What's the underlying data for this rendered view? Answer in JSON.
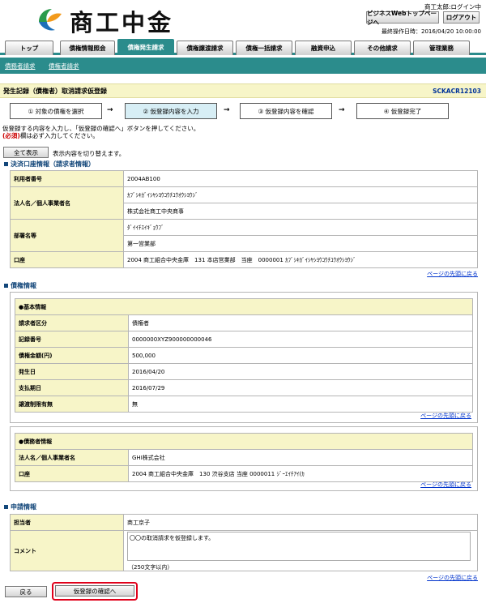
{
  "header": {
    "logo_text": "商工中金",
    "user": "商工太郎:ログイン中",
    "btn_portal": "ビジネスWebトップページへ",
    "btn_logout": "ログアウト",
    "last_operation": "最終操作日時：2016/04/20 10:00:00"
  },
  "tabs": [
    "トップ",
    "債権情報照会",
    "債権発生請求",
    "債権譲渡請求",
    "債権一括請求",
    "融資申込",
    "その他請求",
    "管理業務"
  ],
  "subnav": [
    "債務者請求",
    "債権者請求"
  ],
  "title": "発生記録（債権者）取消請求仮登録",
  "screen_code": "SCKACR12103",
  "steps": [
    "① 対象の債権を選択",
    "② 仮登録内容を入力",
    "③ 仮登録内容を確認",
    "④ 仮登録完了"
  ],
  "instruction1": "仮登録する内容を入力し、「仮登録の確認へ」ボタンを押してください。",
  "required_mark": "(必須)",
  "instruction2": "欄は必ず入力してください。",
  "toggle_button": "全て表示",
  "toggle_note": "表示内容を切り替えます。",
  "settlement": {
    "heading": "決済口座情報（請求者情報）",
    "user_no_label": "利用者番号",
    "user_no": "2004AB100",
    "name_label": "法人名／個人事業者名",
    "name_kana": "ｶﾌﾞｼｷｶﾞｲｼﾔｼﾖｳｺｳﾁﾕｳｵｳｼﾖｳｼﾞ",
    "name": "株式会社商工中央商事",
    "dept_label": "部署名等",
    "dept_kana": "ﾀﾞｲｲﾁｴｲｷﾞｮｳﾌﾞ",
    "dept": "第一営業部",
    "account_label": "口座",
    "account": "2004 商工組合中央金庫　131 本店営業部　当座　0000001 ｶﾌﾞｼｷｶﾞｲｼﾔｼﾖｳｺｳﾁﾕｳｵｳｼﾖｳｼﾞ"
  },
  "to_top": "ページの先頭に戻る",
  "claim": {
    "heading": "債権情報",
    "basic_heading": "●基本情報",
    "rows": [
      {
        "label": "請求者区分",
        "value": "債権者"
      },
      {
        "label": "記録番号",
        "value": "0000000XYZ900000000046"
      },
      {
        "label": "債権金額(円)",
        "value": "500,000"
      },
      {
        "label": "発生日",
        "value": "2016/04/20"
      },
      {
        "label": "支払期日",
        "value": "2016/07/29"
      },
      {
        "label": "譲渡制限有無",
        "value": "無"
      }
    ],
    "debtor_heading": "●債務者情報",
    "debtor_rows": [
      {
        "label": "法人名／個人事業者名",
        "value": "GHI株式会社"
      },
      {
        "label": "口座",
        "value": "2004 商工組合中央金庫　130 渋谷支店 当座 0000011 ｼﾞｰｴｲﾁｱｲ(ｶ"
      }
    ]
  },
  "application": {
    "heading": "申請情報",
    "person_label": "担当者",
    "person": "商工京子",
    "comment_label": "コメント",
    "comment": "〇〇の取消請求を仮登録します。",
    "comment_limit": "（250文字以内）"
  },
  "back_button": "戻る",
  "confirm_button": "仮登録の確認へ"
}
